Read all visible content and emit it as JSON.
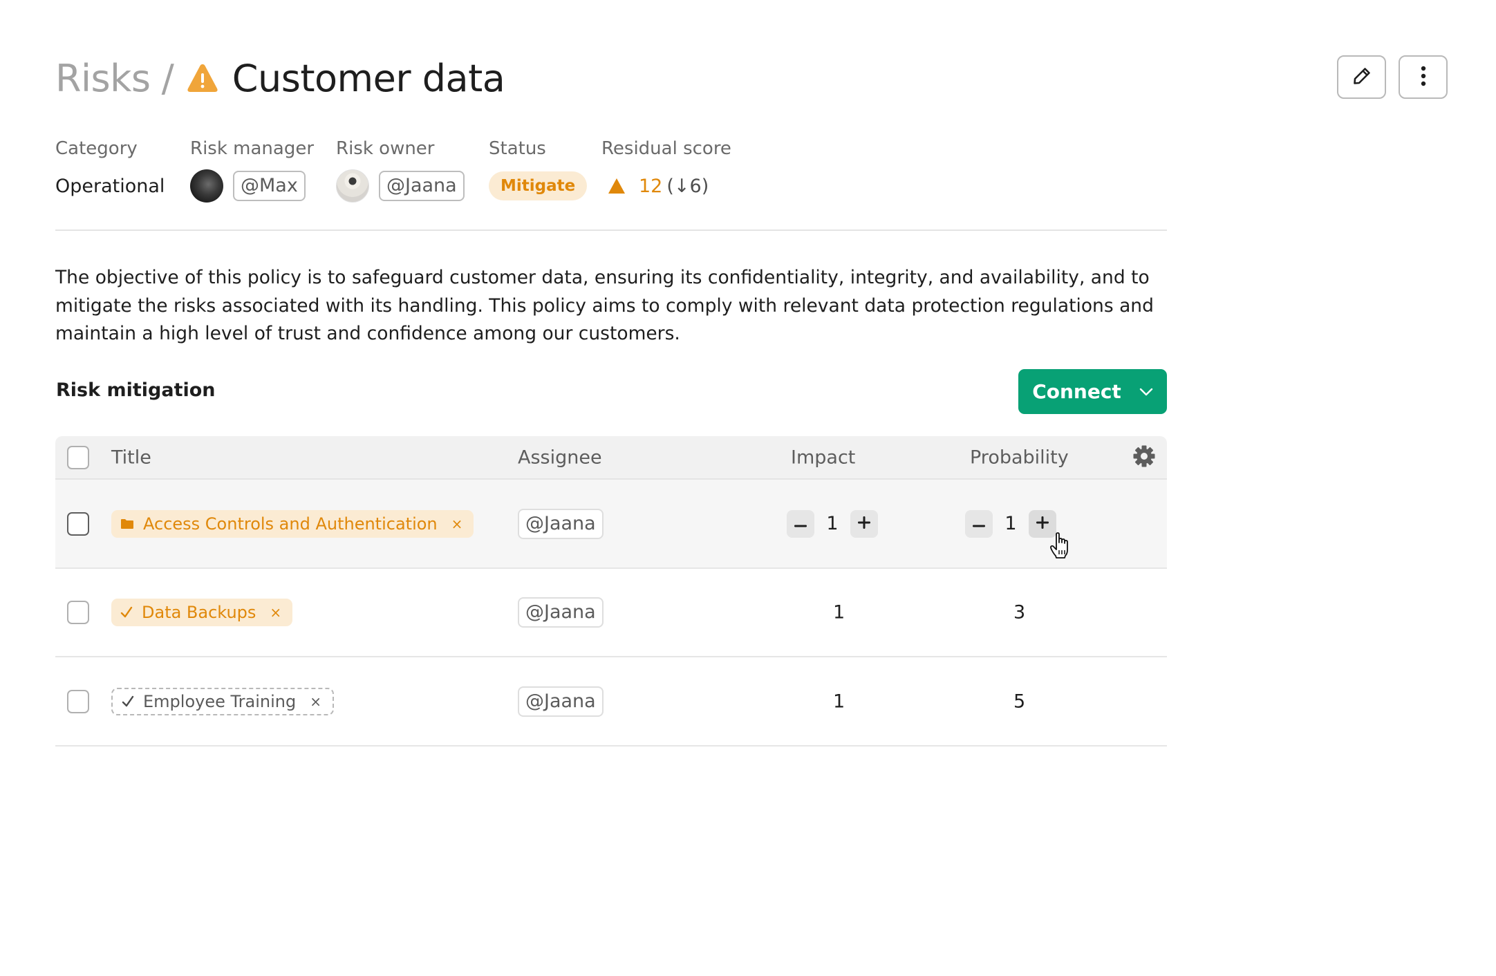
{
  "header": {
    "breadcrumb_parent": "Risks",
    "breadcrumb_separator": "/",
    "title": "Customer data",
    "title_icon": "warning-triangle-icon",
    "actions": [
      {
        "name": "edit",
        "icon": "pencil-icon"
      },
      {
        "name": "more",
        "icon": "more-vertical-icon"
      }
    ]
  },
  "meta": {
    "category": {
      "label": "Category",
      "value": "Operational"
    },
    "risk_manager": {
      "label": "Risk manager",
      "value": "@Max"
    },
    "risk_owner": {
      "label": "Risk owner",
      "value": "@Jaana"
    },
    "status": {
      "label": "Status",
      "value": "Mitigate"
    },
    "residual_score": {
      "label": "Residual score",
      "value": "12",
      "delta": "(↓6)"
    }
  },
  "description": "The objective of this policy is to safeguard customer data, ensuring its confidentiality, integrity, and availability, and to mitigate the risks associated with its handling. This policy aims to comply with relevant data protection regulations and maintain a high level of trust and confidence among our customers.",
  "mitigation": {
    "section_title": "Risk mitigation",
    "connect_label": "Connect",
    "columns": {
      "title": "Title",
      "assignee": "Assignee",
      "impact": "Impact",
      "probability": "Probability"
    },
    "rows": [
      {
        "title": "Access Controls and Authentication",
        "tag_icon": "folder-icon",
        "tag_style": "orange",
        "assignee": "@Jaana",
        "impact": "1",
        "probability": "1",
        "editable": true
      },
      {
        "title": "Data Backups",
        "tag_icon": "check-icon",
        "tag_style": "orange",
        "assignee": "@Jaana",
        "impact": "1",
        "probability": "3",
        "editable": false
      },
      {
        "title": "Employee Training",
        "tag_icon": "check-icon",
        "tag_style": "dashed",
        "assignee": "@Jaana",
        "impact": "1",
        "probability": "5",
        "editable": false
      }
    ],
    "remove_glyph": "×"
  },
  "colors": {
    "accent_orange": "#e0880a",
    "badge_bg": "#fbebd3",
    "primary_green": "#08a175"
  }
}
